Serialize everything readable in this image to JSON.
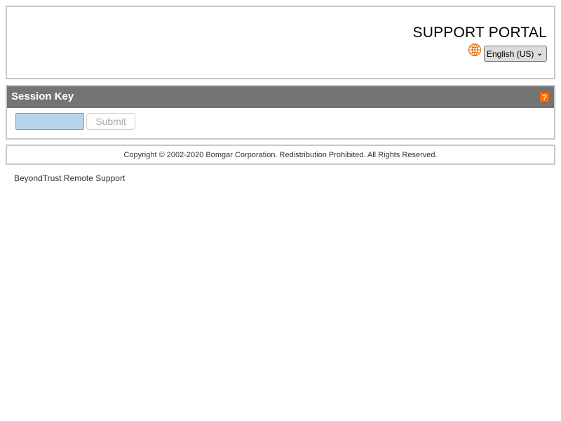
{
  "header": {
    "title": "SUPPORT PORTAL",
    "language": {
      "icon": "globe-icon",
      "selected": "English (US)"
    }
  },
  "session": {
    "title": "Session Key",
    "help_label": "?",
    "input_value": "",
    "submit_label": "Submit"
  },
  "footer": {
    "copyright": "Copyright © 2002-2020 Bomgar Corporation. Redistribution Prohibited. All Rights Reserved."
  },
  "brand": {
    "text": "BeyondTrust Remote Support"
  },
  "colors": {
    "accent_help": "#ff6b00",
    "bar_background": "#747474",
    "input_background": "#b7d4ea",
    "globe_icon": "#e06a00"
  }
}
